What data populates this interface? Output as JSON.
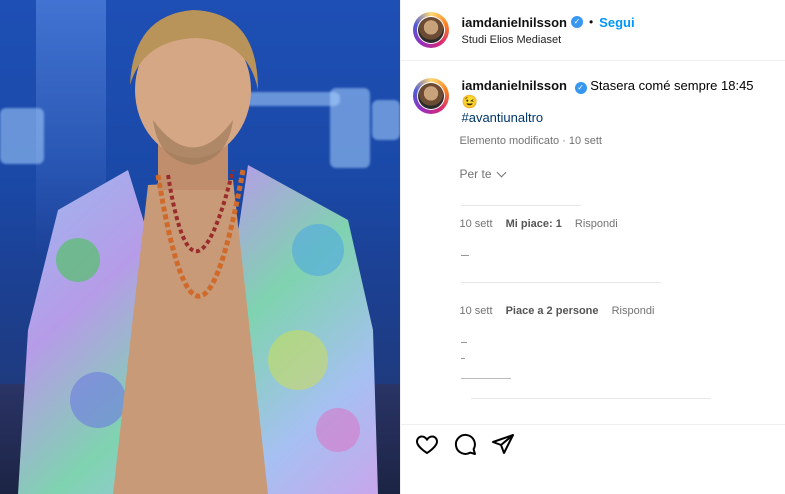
{
  "post": {
    "username": "iamdanielnilsson",
    "follow_label": "Segui",
    "location": "Studi Elios Mediaset",
    "separator": "•"
  },
  "caption": {
    "username": "iamdanielnilsson",
    "text": "Stasera comé sempre 18:45 😉",
    "hashtag": "#avantiunaltro",
    "edited_meta": "Elemento modificato · 10 sett"
  },
  "filter": {
    "label": "Per te"
  },
  "comments": [
    {
      "time": "10 sett",
      "likes": "Mi piace: 1",
      "reply": "Rispondi"
    },
    {
      "time": "10 sett",
      "likes": "Piace a 2 persone",
      "reply": "Rispondi"
    }
  ],
  "icons": [
    "heart-icon",
    "comment-icon",
    "share-icon",
    "verified-icon"
  ],
  "colors": {
    "accent": "#0095f6",
    "hashtag": "#00376b",
    "verified": "#3897f0",
    "muted": "#737373"
  }
}
